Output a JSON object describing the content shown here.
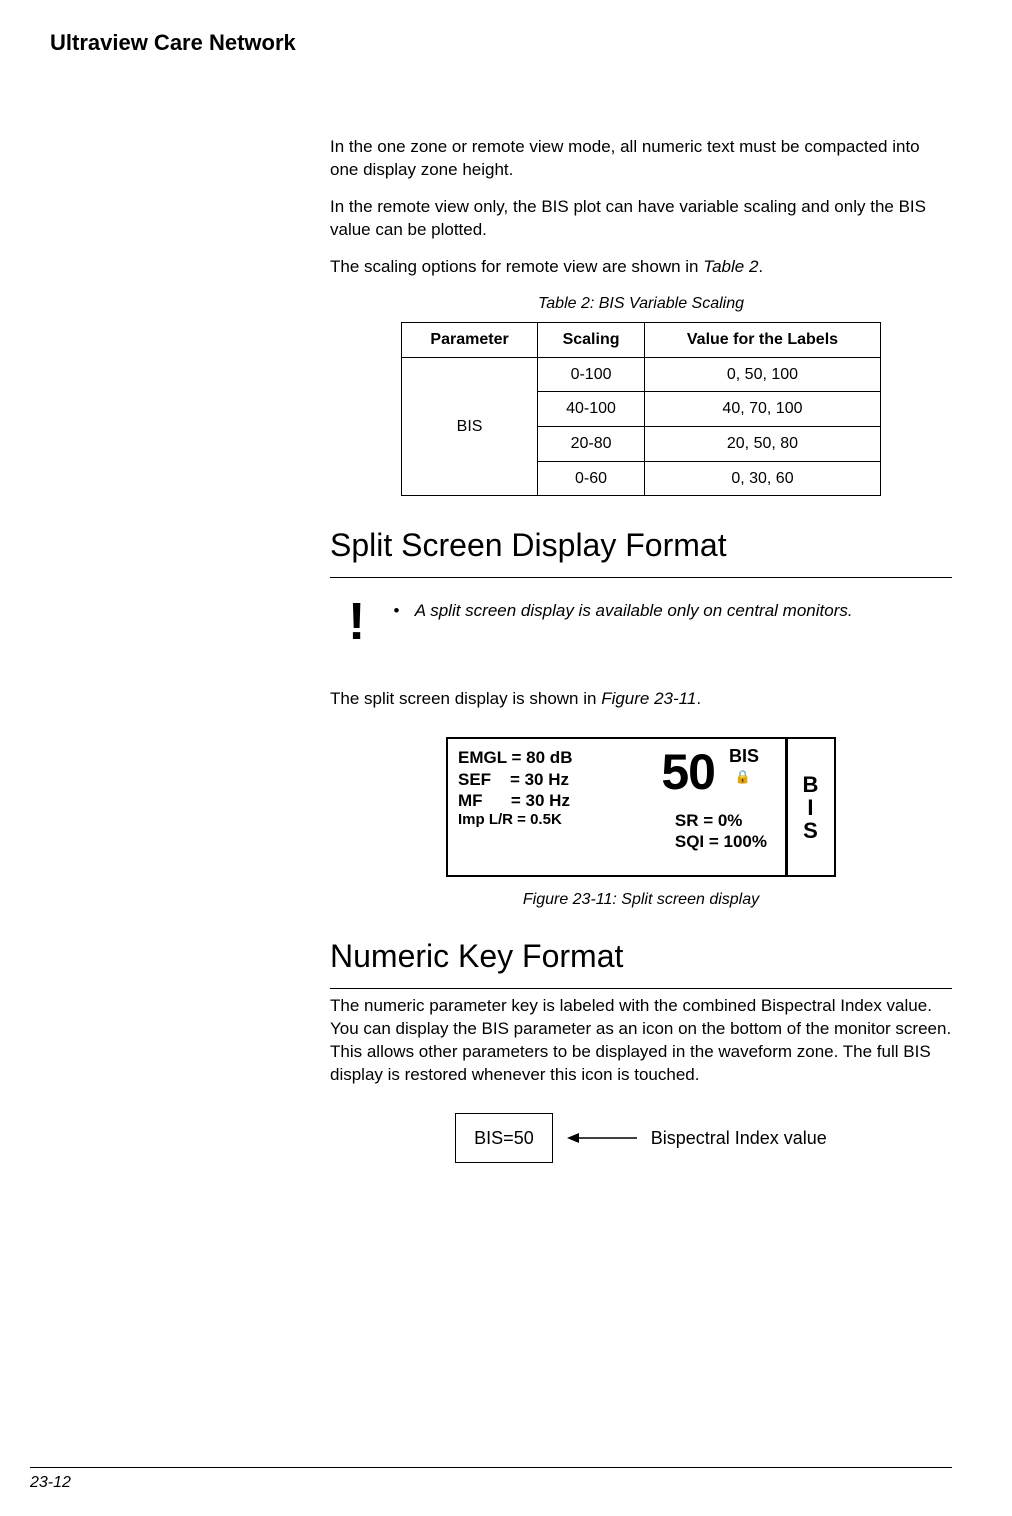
{
  "header": {
    "title": "Ultraview Care Network"
  },
  "intro": {
    "p1": "In the one zone or remote view mode, all numeric text must be compacted into one display zone height.",
    "p2": "In the remote view only, the BIS plot can have variable scaling and only the BIS value can be plotted.",
    "p3_prefix": "The scaling options for remote view are shown in ",
    "p3_ref": "Table 2",
    "p3_suffix": "."
  },
  "table2": {
    "caption": "Table 2: BIS Variable Scaling",
    "headers": {
      "parameter": "Parameter",
      "scaling": "Scaling",
      "labels": "Value for the Labels"
    },
    "parameter": "BIS",
    "rows": [
      {
        "scaling": "0-100",
        "labels": "0, 50, 100"
      },
      {
        "scaling": "40-100",
        "labels": "40, 70, 100"
      },
      {
        "scaling": "20-80",
        "labels": "20, 50, 80"
      },
      {
        "scaling": "0-60",
        "labels": "0, 30, 60"
      }
    ]
  },
  "split_section": {
    "heading": "Split Screen Display Format",
    "note": "A split screen display is available only on central monitors.",
    "p1_prefix": "The split screen display is shown in ",
    "p1_ref": "Figure 23-11",
    "p1_suffix": "."
  },
  "figure": {
    "emgl": "EMGL = 80 dB",
    "sef": "SEF    = 30 Hz",
    "mf": "MF      = 30 Hz",
    "imp": "Imp L/R = 0.5K",
    "big": "50",
    "bis": "BIS",
    "sr": "SR   =     0%",
    "sqi": "SQI = 100%",
    "side": "B\nI\nS",
    "caption": "Figure 23-11: Split screen display"
  },
  "numeric_section": {
    "heading": "Numeric Key Format",
    "p1": "The numeric parameter key is labeled with the combined Bispectral Index value. You can display the BIS parameter as an icon on the bottom of the monitor screen. This allows other parameters to be displayed in the waveform zone. The full BIS display is restored whenever this icon is touched.",
    "key_label": "BIS=50",
    "callout": "Bispectral Index value"
  },
  "footer": {
    "page": "23-12"
  },
  "chart_data": {
    "type": "table",
    "title": "Table 2: BIS Variable Scaling",
    "columns": [
      "Parameter",
      "Scaling",
      "Value for the Labels"
    ],
    "rows": [
      [
        "BIS",
        "0-100",
        "0, 50, 100"
      ],
      [
        "BIS",
        "40-100",
        "40, 70, 100"
      ],
      [
        "BIS",
        "20-80",
        "20, 50, 80"
      ],
      [
        "BIS",
        "0-60",
        "0, 30, 60"
      ]
    ]
  }
}
